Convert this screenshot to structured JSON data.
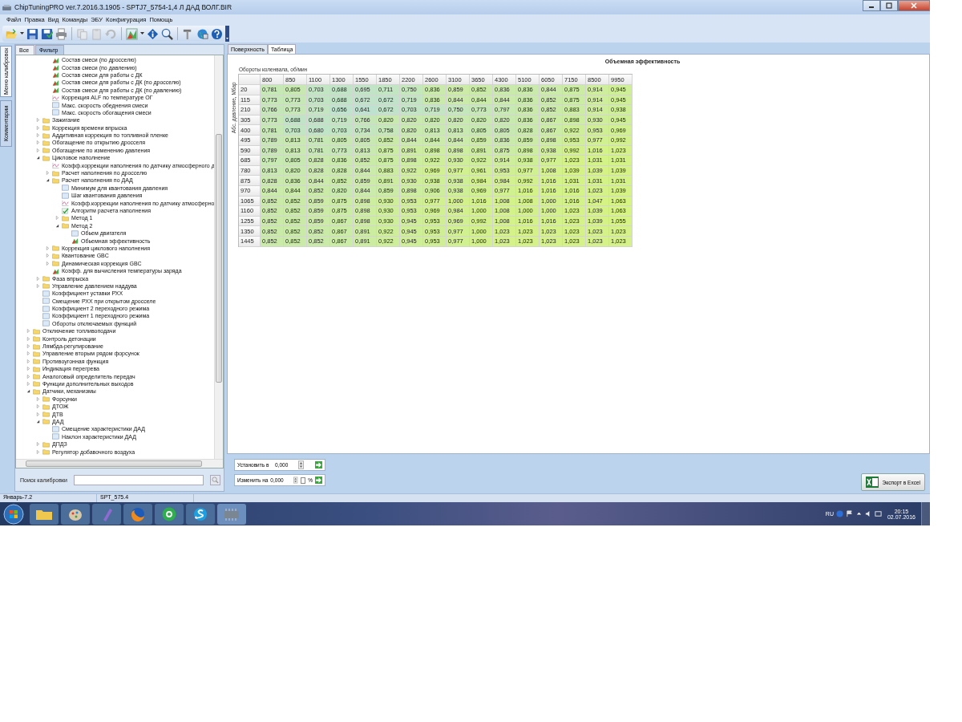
{
  "window": {
    "title": "ChipTuningPRO ver.7.2016.3.1905 - SPTJ7_5754-1,4 Л ДАД ВОЛГ.BIR"
  },
  "menu": [
    "Файл",
    "Правка",
    "Вид",
    "Команды",
    "ЭБУ",
    "Конфигурация",
    "Помощь"
  ],
  "side_tabs": [
    {
      "label": "Меню калибровок",
      "selected": true
    },
    {
      "label": "Комментарии",
      "selected": false
    }
  ],
  "filter_tabs": [
    {
      "label": "Все",
      "selected": false
    },
    {
      "label": "Фильтр",
      "selected": true
    }
  ],
  "tree": {
    "items": [
      {
        "children": [
          {
            "children": [
              {
                "label": "Состав смеси (по дросселю)",
                "kind": "chart"
              },
              {
                "label": "Состав смеси (по давлению)",
                "kind": "chart"
              },
              {
                "label": "Состав смеси для работы с ДК",
                "kind": "chart"
              },
              {
                "label": "Состав смеси для работы с ДК (по дросселю)",
                "kind": "chart"
              },
              {
                "label": "Состав смеси для работы с ДК (по давлению)",
                "kind": "chart"
              },
              {
                "label": "Коррекция ALF по температуре ОГ",
                "kind": "curve"
              },
              {
                "label": "Макс. скорость обеднения смеси",
                "kind": "number"
              },
              {
                "label": "Макс. скорость обогащения смеси",
                "kind": "number"
              }
            ]
          },
          {
            "label": "Зажигание",
            "kind": "folder",
            "expanded": false
          },
          {
            "label": "Коррекция времени впрыска",
            "kind": "folder",
            "expanded": false
          },
          {
            "label": "Аддитивная коррекция по топливной пленке",
            "kind": "folder",
            "expanded": false
          },
          {
            "label": "Обогащение по открытию дросселя",
            "kind": "folder",
            "expanded": false
          },
          {
            "label": "Обогащение по изменению давления",
            "kind": "folder",
            "expanded": false
          },
          {
            "label": "Цикловое наполнение",
            "kind": "folder",
            "expanded": true,
            "children": [
              {
                "label": "Коэфф.коррекции наполнения по датчику атмосферного д",
                "kind": "curve"
              },
              {
                "label": "Расчет наполнения по дросселю",
                "kind": "folder",
                "expanded": false
              },
              {
                "label": "Расчет наполнения по ДАД",
                "kind": "folder",
                "expanded": true,
                "children": [
                  {
                    "label": "Минимум для квантования давления",
                    "kind": "number"
                  },
                  {
                    "label": "Шаг квантования давления",
                    "kind": "number"
                  },
                  {
                    "label": "Коэфф.коррекции наполнения по датчику атмосферно",
                    "kind": "curve"
                  },
                  {
                    "label": "Алгоритм расчета наполнения",
                    "kind": "check"
                  },
                  {
                    "label": "Метод 1",
                    "kind": "folder",
                    "expanded": false
                  },
                  {
                    "label": "Метод 2",
                    "kind": "folder",
                    "expanded": true,
                    "children": [
                      {
                        "label": "Обьем двигателя",
                        "kind": "number"
                      },
                      {
                        "label": "Обьемная эффективность",
                        "kind": "chart"
                      }
                    ]
                  }
                ]
              },
              {
                "label": "Коррекция циклового наполнения",
                "kind": "folder",
                "expanded": false
              },
              {
                "label": "Квантование GBC",
                "kind": "folder",
                "expanded": false
              },
              {
                "label": "Динамическая коррекция GBC",
                "kind": "folder",
                "expanded": false
              },
              {
                "label": "Коэфф. для вычисления температуры заряда",
                "kind": "chart"
              }
            ]
          },
          {
            "label": "Фаза впрыска",
            "kind": "folder",
            "expanded": false
          },
          {
            "label": "Управление давлением наддува",
            "kind": "folder",
            "expanded": false
          },
          {
            "label": "Коэффициент уставки РХХ",
            "kind": "number"
          },
          {
            "label": "Смещение РХХ при открытом дросселе",
            "kind": "number"
          },
          {
            "label": "Коэффициент 2 переходного режима",
            "kind": "number"
          },
          {
            "label": "Коэффициент 1 переходного режима",
            "kind": "number"
          },
          {
            "label": "Обороты отключаемых функций",
            "kind": "number"
          }
        ]
      },
      {
        "label": "Отключение топливоподачи",
        "kind": "folder",
        "expanded": false
      },
      {
        "label": "Контроль детонации",
        "kind": "folder",
        "expanded": false
      },
      {
        "label": "Лямбда-регулирование",
        "kind": "folder",
        "expanded": false
      },
      {
        "label": "Управление вторым рядом форсунок",
        "kind": "folder",
        "expanded": false
      },
      {
        "label": "Противоугонная функция",
        "kind": "folder",
        "expanded": false
      },
      {
        "label": "Индикация перегрева",
        "kind": "folder",
        "expanded": false
      },
      {
        "label": "Аналоговый определитель передач",
        "kind": "folder",
        "expanded": false
      },
      {
        "label": "Функции дополнительных выходов",
        "kind": "folder",
        "expanded": false
      },
      {
        "label": "Датчики, механизмы",
        "kind": "folder",
        "expanded": true,
        "children": [
          {
            "label": "Форсунки",
            "kind": "folder",
            "expanded": false
          },
          {
            "label": "ДТОЖ",
            "kind": "folder",
            "expanded": false
          },
          {
            "label": "ДТВ",
            "kind": "folder",
            "expanded": false
          },
          {
            "label": "ДАД",
            "kind": "folder",
            "expanded": true,
            "children": [
              {
                "label": "Смещение характеристики ДАД",
                "kind": "number"
              },
              {
                "label": "Наклон характеристики ДАД",
                "kind": "number"
              }
            ]
          },
          {
            "label": "ДПДЗ",
            "kind": "folder",
            "expanded": false
          },
          {
            "label": "Регулятор добавочного воздуха",
            "kind": "folder",
            "expanded": false
          }
        ]
      }
    ]
  },
  "search": {
    "label": "Поиск калибровки"
  },
  "view_tabs": [
    {
      "label": "Поверхность",
      "selected": false
    },
    {
      "label": "Таблица",
      "selected": true
    }
  ],
  "table": {
    "title": "Объемная эффективность",
    "x_label": "Обороты коленвала, об/мин",
    "y_label": "Абс. давление, Мбар",
    "columns": [
      "800",
      "850",
      "1100",
      "1300",
      "1550",
      "1850",
      "2200",
      "2600",
      "3100",
      "3650",
      "4300",
      "5100",
      "6050",
      "7150",
      "8500",
      "9950"
    ],
    "rows": [
      {
        "header": "20",
        "cells": [
          "0,781",
          "0,805",
          "0,703",
          "0,688",
          "0,695",
          "0,711",
          "0,750",
          "0,836",
          "0,859",
          "0,852",
          "0,836",
          "0,836",
          "0,844",
          "0,875",
          "0,914",
          "0,945"
        ]
      },
      {
        "header": "115",
        "cells": [
          "0,773",
          "0,773",
          "0,703",
          "0,688",
          "0,672",
          "0,672",
          "0,719",
          "0,836",
          "0,844",
          "0,844",
          "0,844",
          "0,836",
          "0,852",
          "0,875",
          "0,914",
          "0,945"
        ]
      },
      {
        "header": "210",
        "cells": [
          "0,766",
          "0,773",
          "0,719",
          "0,656",
          "0,641",
          "0,672",
          "0,703",
          "0,719",
          "0,750",
          "0,773",
          "0,797",
          "0,836",
          "0,852",
          "0,883",
          "0,914",
          "0,938"
        ]
      },
      {
        "header": "305",
        "cells": [
          "0,773",
          "0,688",
          "0,688",
          "0,719",
          "0,766",
          "0,820",
          "0,820",
          "0,820",
          "0,820",
          "0,820",
          "0,820",
          "0,836",
          "0,867",
          "0,898",
          "0,930",
          "0,945"
        ]
      },
      {
        "header": "400",
        "cells": [
          "0,781",
          "0,703",
          "0,680",
          "0,703",
          "0,734",
          "0,758",
          "0,820",
          "0,813",
          "0,813",
          "0,805",
          "0,805",
          "0,828",
          "0,867",
          "0,922",
          "0,953",
          "0,969"
        ]
      },
      {
        "header": "495",
        "cells": [
          "0,789",
          "0,813",
          "0,781",
          "0,805",
          "0,805",
          "0,852",
          "0,844",
          "0,844",
          "0,844",
          "0,859",
          "0,836",
          "0,859",
          "0,898",
          "0,953",
          "0,977",
          "0,992"
        ]
      },
      {
        "header": "590",
        "cells": [
          "0,789",
          "0,813",
          "0,781",
          "0,773",
          "0,813",
          "0,875",
          "0,891",
          "0,898",
          "0,898",
          "0,891",
          "0,875",
          "0,898",
          "0,938",
          "0,992",
          "1,016",
          "1,023"
        ]
      },
      {
        "header": "685",
        "cells": [
          "0,797",
          "0,805",
          "0,828",
          "0,836",
          "0,852",
          "0,875",
          "0,898",
          "0,922",
          "0,930",
          "0,922",
          "0,914",
          "0,938",
          "0,977",
          "1,023",
          "1,031",
          "1,031"
        ]
      },
      {
        "header": "780",
        "cells": [
          "0,813",
          "0,820",
          "0,828",
          "0,828",
          "0,844",
          "0,883",
          "0,922",
          "0,969",
          "0,977",
          "0,961",
          "0,953",
          "0,977",
          "1,008",
          "1,039",
          "1,039",
          "1,039"
        ]
      },
      {
        "header": "875",
        "cells": [
          "0,828",
          "0,836",
          "0,844",
          "0,852",
          "0,859",
          "0,891",
          "0,930",
          "0,938",
          "0,938",
          "0,984",
          "0,984",
          "0,992",
          "1,016",
          "1,031",
          "1,031",
          "1,031"
        ]
      },
      {
        "header": "970",
        "cells": [
          "0,844",
          "0,844",
          "0,852",
          "0,820",
          "0,844",
          "0,859",
          "0,898",
          "0,906",
          "0,938",
          "0,969",
          "0,977",
          "1,016",
          "1,016",
          "1,016",
          "1,023",
          "1,039"
        ]
      },
      {
        "header": "1065",
        "cells": [
          "0,852",
          "0,852",
          "0,859",
          "0,875",
          "0,898",
          "0,930",
          "0,953",
          "0,977",
          "1,000",
          "1,016",
          "1,008",
          "1,008",
          "1,000",
          "1,016",
          "1,047",
          "1,063"
        ]
      },
      {
        "header": "1160",
        "cells": [
          "0,852",
          "0,852",
          "0,859",
          "0,875",
          "0,898",
          "0,930",
          "0,953",
          "0,969",
          "0,984",
          "1,000",
          "1,008",
          "1,000",
          "1,000",
          "1,023",
          "1,039",
          "1,063"
        ]
      },
      {
        "header": "1255",
        "cells": [
          "0,852",
          "0,852",
          "0,859",
          "0,867",
          "0,898",
          "0,930",
          "0,945",
          "0,953",
          "0,969",
          "0,992",
          "1,008",
          "1,016",
          "1,016",
          "1,023",
          "1,039",
          "1,055"
        ]
      },
      {
        "header": "1350",
        "cells": [
          "0,852",
          "0,852",
          "0,852",
          "0,867",
          "0,891",
          "0,922",
          "0,945",
          "0,953",
          "0,977",
          "1,000",
          "1,023",
          "1,023",
          "1,023",
          "1,023",
          "1,023",
          "1,023"
        ]
      },
      {
        "header": "1445",
        "cells": [
          "0,852",
          "0,852",
          "0,852",
          "0,867",
          "0,891",
          "0,922",
          "0,945",
          "0,953",
          "0,977",
          "1,000",
          "1,023",
          "1,023",
          "1,023",
          "1,023",
          "1,023",
          "1,023"
        ]
      }
    ]
  },
  "set_control": {
    "label": "Установить в",
    "value": "0,000"
  },
  "change_control": {
    "label": "Изменить на",
    "value": "0,000",
    "percent_checked": false,
    "percent_label": "%"
  },
  "export_button": {
    "label": "Экспорт в Excel"
  },
  "status_bar": [
    "Январь-7.2",
    "SPT_575.4"
  ],
  "taskbar": {
    "language": "RU",
    "time": "20:15",
    "date": "02.07.2016"
  }
}
